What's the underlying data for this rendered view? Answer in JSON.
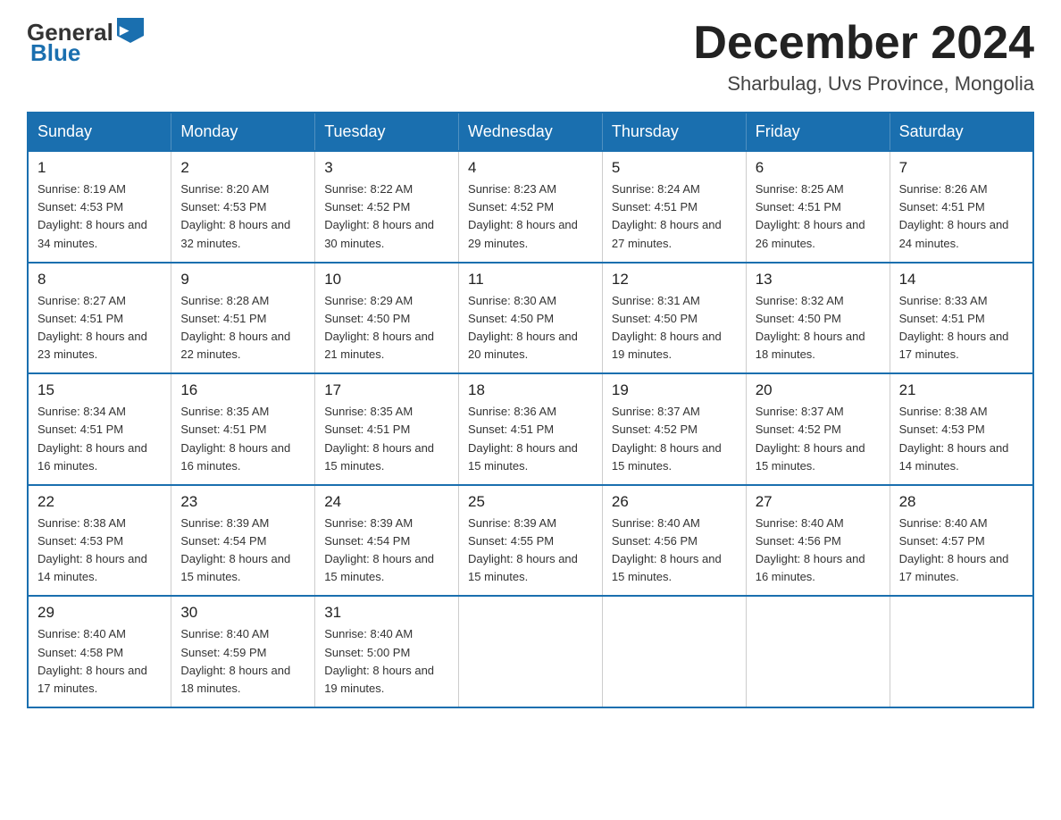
{
  "header": {
    "logo_general": "General",
    "logo_blue": "Blue",
    "month_title": "December 2024",
    "location": "Sharbulag, Uvs Province, Mongolia"
  },
  "weekdays": [
    "Sunday",
    "Monday",
    "Tuesday",
    "Wednesday",
    "Thursday",
    "Friday",
    "Saturday"
  ],
  "weeks": [
    [
      {
        "day": "1",
        "sunrise": "8:19 AM",
        "sunset": "4:53 PM",
        "daylight": "8 hours and 34 minutes."
      },
      {
        "day": "2",
        "sunrise": "8:20 AM",
        "sunset": "4:53 PM",
        "daylight": "8 hours and 32 minutes."
      },
      {
        "day": "3",
        "sunrise": "8:22 AM",
        "sunset": "4:52 PM",
        "daylight": "8 hours and 30 minutes."
      },
      {
        "day": "4",
        "sunrise": "8:23 AM",
        "sunset": "4:52 PM",
        "daylight": "8 hours and 29 minutes."
      },
      {
        "day": "5",
        "sunrise": "8:24 AM",
        "sunset": "4:51 PM",
        "daylight": "8 hours and 27 minutes."
      },
      {
        "day": "6",
        "sunrise": "8:25 AM",
        "sunset": "4:51 PM",
        "daylight": "8 hours and 26 minutes."
      },
      {
        "day": "7",
        "sunrise": "8:26 AM",
        "sunset": "4:51 PM",
        "daylight": "8 hours and 24 minutes."
      }
    ],
    [
      {
        "day": "8",
        "sunrise": "8:27 AM",
        "sunset": "4:51 PM",
        "daylight": "8 hours and 23 minutes."
      },
      {
        "day": "9",
        "sunrise": "8:28 AM",
        "sunset": "4:51 PM",
        "daylight": "8 hours and 22 minutes."
      },
      {
        "day": "10",
        "sunrise": "8:29 AM",
        "sunset": "4:50 PM",
        "daylight": "8 hours and 21 minutes."
      },
      {
        "day": "11",
        "sunrise": "8:30 AM",
        "sunset": "4:50 PM",
        "daylight": "8 hours and 20 minutes."
      },
      {
        "day": "12",
        "sunrise": "8:31 AM",
        "sunset": "4:50 PM",
        "daylight": "8 hours and 19 minutes."
      },
      {
        "day": "13",
        "sunrise": "8:32 AM",
        "sunset": "4:50 PM",
        "daylight": "8 hours and 18 minutes."
      },
      {
        "day": "14",
        "sunrise": "8:33 AM",
        "sunset": "4:51 PM",
        "daylight": "8 hours and 17 minutes."
      }
    ],
    [
      {
        "day": "15",
        "sunrise": "8:34 AM",
        "sunset": "4:51 PM",
        "daylight": "8 hours and 16 minutes."
      },
      {
        "day": "16",
        "sunrise": "8:35 AM",
        "sunset": "4:51 PM",
        "daylight": "8 hours and 16 minutes."
      },
      {
        "day": "17",
        "sunrise": "8:35 AM",
        "sunset": "4:51 PM",
        "daylight": "8 hours and 15 minutes."
      },
      {
        "day": "18",
        "sunrise": "8:36 AM",
        "sunset": "4:51 PM",
        "daylight": "8 hours and 15 minutes."
      },
      {
        "day": "19",
        "sunrise": "8:37 AM",
        "sunset": "4:52 PM",
        "daylight": "8 hours and 15 minutes."
      },
      {
        "day": "20",
        "sunrise": "8:37 AM",
        "sunset": "4:52 PM",
        "daylight": "8 hours and 15 minutes."
      },
      {
        "day": "21",
        "sunrise": "8:38 AM",
        "sunset": "4:53 PM",
        "daylight": "8 hours and 14 minutes."
      }
    ],
    [
      {
        "day": "22",
        "sunrise": "8:38 AM",
        "sunset": "4:53 PM",
        "daylight": "8 hours and 14 minutes."
      },
      {
        "day": "23",
        "sunrise": "8:39 AM",
        "sunset": "4:54 PM",
        "daylight": "8 hours and 15 minutes."
      },
      {
        "day": "24",
        "sunrise": "8:39 AM",
        "sunset": "4:54 PM",
        "daylight": "8 hours and 15 minutes."
      },
      {
        "day": "25",
        "sunrise": "8:39 AM",
        "sunset": "4:55 PM",
        "daylight": "8 hours and 15 minutes."
      },
      {
        "day": "26",
        "sunrise": "8:40 AM",
        "sunset": "4:56 PM",
        "daylight": "8 hours and 15 minutes."
      },
      {
        "day": "27",
        "sunrise": "8:40 AM",
        "sunset": "4:56 PM",
        "daylight": "8 hours and 16 minutes."
      },
      {
        "day": "28",
        "sunrise": "8:40 AM",
        "sunset": "4:57 PM",
        "daylight": "8 hours and 17 minutes."
      }
    ],
    [
      {
        "day": "29",
        "sunrise": "8:40 AM",
        "sunset": "4:58 PM",
        "daylight": "8 hours and 17 minutes."
      },
      {
        "day": "30",
        "sunrise": "8:40 AM",
        "sunset": "4:59 PM",
        "daylight": "8 hours and 18 minutes."
      },
      {
        "day": "31",
        "sunrise": "8:40 AM",
        "sunset": "5:00 PM",
        "daylight": "8 hours and 19 minutes."
      },
      null,
      null,
      null,
      null
    ]
  ]
}
